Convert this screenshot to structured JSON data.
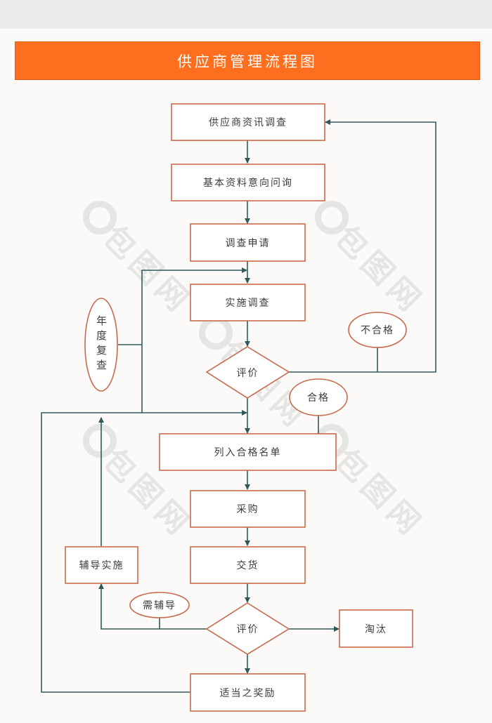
{
  "title": "供应商管理流程图",
  "colors": {
    "header": "#fd6f1e",
    "node_border": "#c8694a",
    "connector": "#2f5a5c",
    "background": "#fbfaf8"
  },
  "nodes": {
    "supplier_survey": "供应商资讯调查",
    "basic_inquiry": "基本资料意向问询",
    "survey_application": "调查申请",
    "conduct_survey": "实施调查",
    "evaluate_1": "评价",
    "unqualified": "不合格",
    "qualified": "合格",
    "annual_review": "年度复查",
    "add_qualified_list": "列入合格名单",
    "purchase": "采购",
    "delivery": "交货",
    "coaching_impl": "辅导实施",
    "needs_coaching": "需辅导",
    "evaluate_2": "评价",
    "eliminate": "淘汰",
    "reward": "适当之奖励"
  },
  "edges": [
    {
      "from": "supplier_survey",
      "to": "basic_inquiry"
    },
    {
      "from": "basic_inquiry",
      "to": "survey_application"
    },
    {
      "from": "survey_application",
      "to": "conduct_survey"
    },
    {
      "from": "conduct_survey",
      "to": "evaluate_1"
    },
    {
      "from": "evaluate_1",
      "to": "supplier_survey",
      "label": "不合格"
    },
    {
      "from": "evaluate_1",
      "to": "add_qualified_list",
      "label": "合格"
    },
    {
      "from": "annual_review",
      "to": "conduct_survey"
    },
    {
      "from": "annual_review",
      "to": "add_qualified_list"
    },
    {
      "from": "add_qualified_list",
      "to": "purchase"
    },
    {
      "from": "purchase",
      "to": "delivery"
    },
    {
      "from": "delivery",
      "to": "evaluate_2"
    },
    {
      "from": "evaluate_2",
      "to": "coaching_impl",
      "label": "需辅导"
    },
    {
      "from": "coaching_impl",
      "to": "add_qualified_list"
    },
    {
      "from": "evaluate_2",
      "to": "eliminate"
    },
    {
      "from": "evaluate_2",
      "to": "reward"
    },
    {
      "from": "reward",
      "to": "add_qualified_list"
    }
  ],
  "watermark": "包图网"
}
